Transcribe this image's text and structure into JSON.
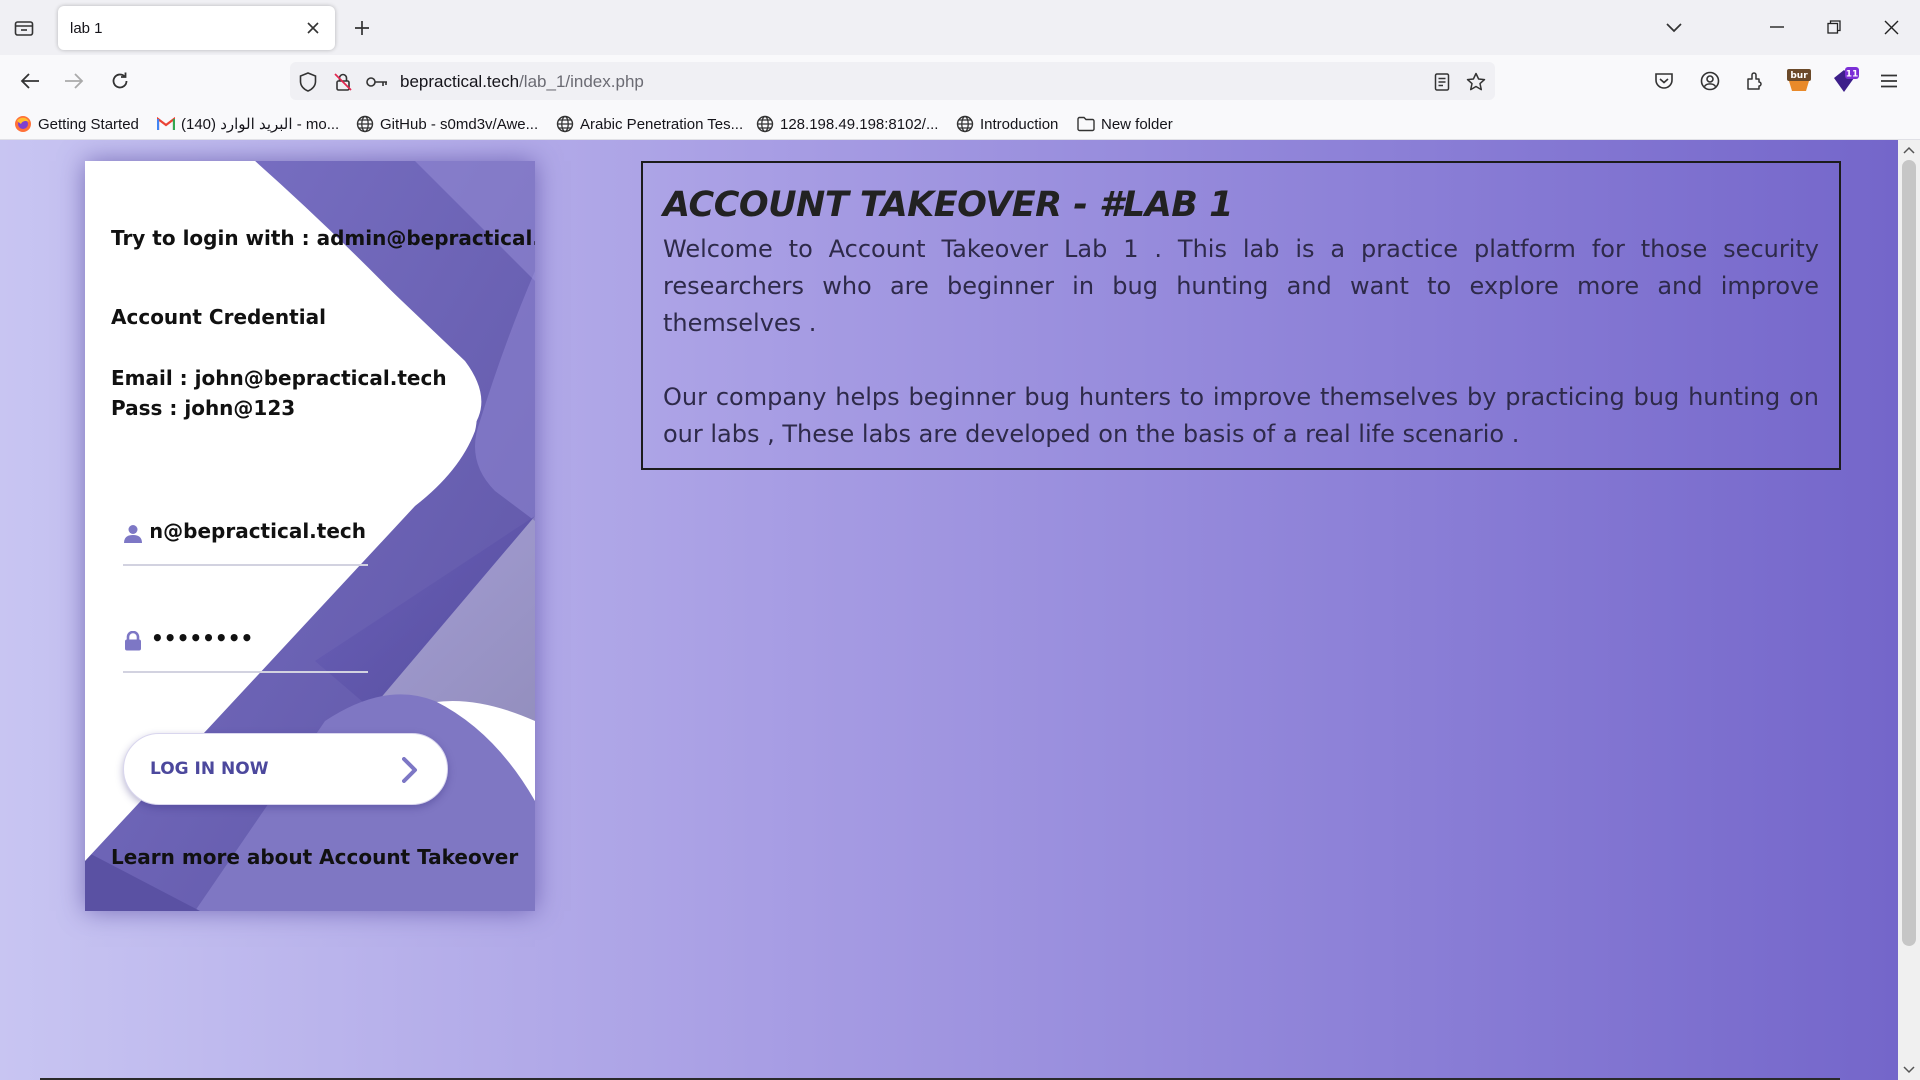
{
  "browser": {
    "tab": {
      "title": "lab 1"
    },
    "url": {
      "host": "bepractical.tech",
      "path": "/lab_1/index.php"
    },
    "extension_badges": {
      "burp": "bur",
      "counter": "11"
    },
    "bookmarks": [
      {
        "label": "Getting Started",
        "icon": "firefox-icon"
      },
      {
        "label": "البريد الوارد (140) - mo...",
        "icon": "gmail-icon"
      },
      {
        "label": "GitHub - s0md3v/Awe...",
        "icon": "globe-icon"
      },
      {
        "label": "Arabic Penetration Tes...",
        "icon": "globe-icon"
      },
      {
        "label": "128.198.49.198:8102/...",
        "icon": "globe-icon"
      },
      {
        "label": "Introduction",
        "icon": "globe-icon"
      },
      {
        "label": "New folder",
        "icon": "folder-icon"
      }
    ]
  },
  "login": {
    "hint": "Try to login with : admin@bepractical.tech",
    "credential_title": "Account Credential",
    "credential_email": "Email : john@bepractical.tech",
    "credential_pass": "Pass : john@123",
    "username_value": "john@bepractical.tech",
    "password_value": "••••••••",
    "button_label": "LOG IN NOW",
    "learn_more": "Learn more about Account Takeover"
  },
  "info": {
    "title": "ACCOUNT TAKEOVER - #LAB 1",
    "paragraph1": "Welcome to Account Takeover Lab 1 . This lab is a practice platform for those security researchers who are beginner in bug hunting and want to explore more and improve themselves .",
    "paragraph2": "Our company helps beginner bug hunters to improve themselves by practicing bug hunting on our labs , These labs are developed on the basis of a real life scenario ."
  },
  "colors": {
    "accent": "#4c489d",
    "gradient_start": "#c8c5f2",
    "gradient_end": "#7466ca"
  }
}
